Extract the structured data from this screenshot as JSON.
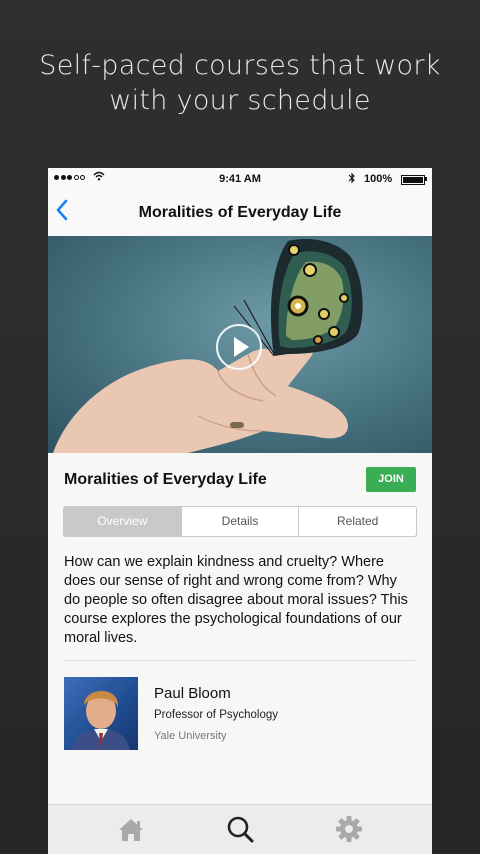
{
  "headline": {
    "line1": "Self-paced courses that work",
    "line2": "with your schedule"
  },
  "status_bar": {
    "signal_bars_filled": 3,
    "signal_bars_total": 5,
    "wifi_icon": "wifi-icon",
    "time": "9:41 AM",
    "bluetooth_icon": "bluetooth-icon",
    "battery": "100%"
  },
  "nav": {
    "back_icon": "chevron-left-icon",
    "title": "Moralities of Everyday Life"
  },
  "hero": {
    "play_icon": "play-icon"
  },
  "course": {
    "title": "Moralities of Everyday Life",
    "join_label": "JOIN",
    "tabs": [
      {
        "label": "Overview",
        "active": true
      },
      {
        "label": "Details",
        "active": false
      },
      {
        "label": "Related",
        "active": false
      }
    ],
    "description": "How can we explain kindness and cruelty? Where does our sense of right and wrong come from? Why do people so often disagree about moral issues? This course explores the psychological foundations of our moral lives."
  },
  "instructor": {
    "name": "Paul Bloom",
    "title": "Professor of Psychology",
    "university": "Yale University"
  },
  "tab_bar": [
    {
      "icon": "home-icon",
      "active": false
    },
    {
      "icon": "search-icon",
      "active": true
    },
    {
      "icon": "gear-icon",
      "active": false
    }
  ],
  "colors": {
    "background": "#2b2b2b",
    "accent_blue": "#1a82f7",
    "join_green": "#3aae55",
    "segment_active": "#c9c9c9"
  }
}
